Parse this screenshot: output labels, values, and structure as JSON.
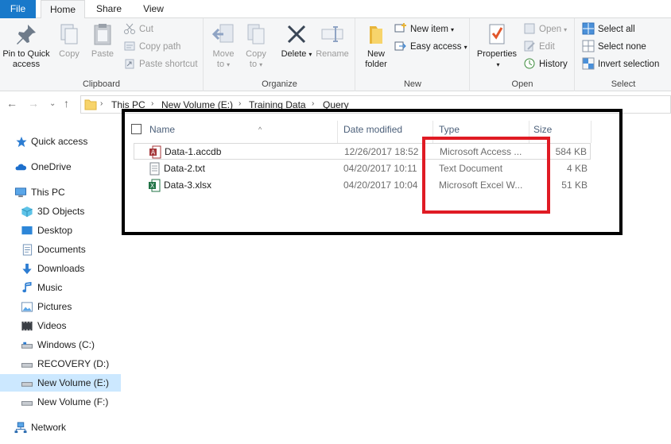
{
  "ribbon_tabs": [
    "File",
    "Home",
    "Share",
    "View"
  ],
  "clipboard": {
    "pin": "Pin to Quick\naccess",
    "copy": "Copy",
    "paste": "Paste",
    "cut": "Cut",
    "copy_path": "Copy path",
    "paste_shortcut": "Paste shortcut",
    "label": "Clipboard"
  },
  "organize": {
    "move_to": "Move\nto",
    "copy_to": "Copy\nto",
    "delete": "Delete",
    "rename": "Rename",
    "label": "Organize"
  },
  "new": {
    "new_folder": "New\nfolder",
    "new_item": "New item",
    "easy_access": "Easy access",
    "label": "New"
  },
  "open": {
    "properties": "Properties",
    "open": "Open",
    "edit": "Edit",
    "history": "History",
    "label": "Open"
  },
  "select": {
    "select_all": "Select all",
    "select_none": "Select none",
    "invert": "Invert selection",
    "label": "Select"
  },
  "breadcrumb": [
    "This PC",
    "New Volume (E:)",
    "Training Data",
    "Query"
  ],
  "nav": [
    {
      "label": "Quick access",
      "icon": "star-icon"
    },
    {
      "label": "OneDrive",
      "icon": "cloud-icon"
    },
    {
      "label": "This PC",
      "icon": "computer-icon"
    },
    {
      "label": "3D Objects",
      "icon": "cube-icon"
    },
    {
      "label": "Desktop",
      "icon": "desktop-icon"
    },
    {
      "label": "Documents",
      "icon": "document-icon"
    },
    {
      "label": "Downloads",
      "icon": "download-icon"
    },
    {
      "label": "Music",
      "icon": "music-icon"
    },
    {
      "label": "Pictures",
      "icon": "picture-icon"
    },
    {
      "label": "Videos",
      "icon": "video-icon"
    },
    {
      "label": "Windows (C:)",
      "icon": "drive-icon"
    },
    {
      "label": "RECOVERY (D:)",
      "icon": "drive-icon"
    },
    {
      "label": "New Volume (E:)",
      "icon": "drive-icon"
    },
    {
      "label": "New Volume (F:)",
      "icon": "drive-icon"
    },
    {
      "label": "Network",
      "icon": "network-icon"
    }
  ],
  "columns": {
    "name": "Name",
    "date": "Date modified",
    "type": "Type",
    "size": "Size"
  },
  "files": [
    {
      "name": "Data-1.accdb",
      "date": "12/26/2017 18:52",
      "type": "Microsoft Access ...",
      "size": "584 KB",
      "icon": "access-file-icon"
    },
    {
      "name": "Data-2.txt",
      "date": "04/20/2017 10:11",
      "type": "Text Document",
      "size": "4 KB",
      "icon": "text-file-icon"
    },
    {
      "name": "Data-3.xlsx",
      "date": "04/20/2017 10:04",
      "type": "Microsoft Excel W...",
      "size": "51 KB",
      "icon": "excel-file-icon"
    }
  ],
  "colors": {
    "file_tab": "#1979ca",
    "selection": "#cce8ff",
    "highlight_black": "#000000",
    "highlight_red": "#e01b24"
  }
}
